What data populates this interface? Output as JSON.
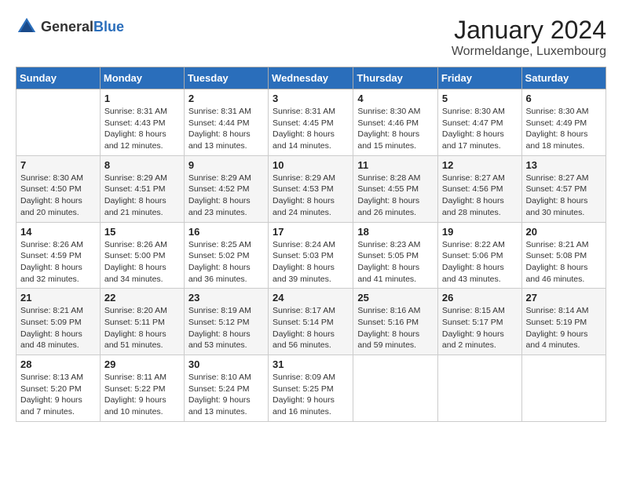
{
  "header": {
    "logo_general": "General",
    "logo_blue": "Blue",
    "month_title": "January 2024",
    "location": "Wormeldange, Luxembourg"
  },
  "days_of_week": [
    "Sunday",
    "Monday",
    "Tuesday",
    "Wednesday",
    "Thursday",
    "Friday",
    "Saturday"
  ],
  "weeks": [
    [
      {
        "num": "",
        "sunrise": "",
        "sunset": "",
        "daylight": ""
      },
      {
        "num": "1",
        "sunrise": "Sunrise: 8:31 AM",
        "sunset": "Sunset: 4:43 PM",
        "daylight": "Daylight: 8 hours and 12 minutes."
      },
      {
        "num": "2",
        "sunrise": "Sunrise: 8:31 AM",
        "sunset": "Sunset: 4:44 PM",
        "daylight": "Daylight: 8 hours and 13 minutes."
      },
      {
        "num": "3",
        "sunrise": "Sunrise: 8:31 AM",
        "sunset": "Sunset: 4:45 PM",
        "daylight": "Daylight: 8 hours and 14 minutes."
      },
      {
        "num": "4",
        "sunrise": "Sunrise: 8:30 AM",
        "sunset": "Sunset: 4:46 PM",
        "daylight": "Daylight: 8 hours and 15 minutes."
      },
      {
        "num": "5",
        "sunrise": "Sunrise: 8:30 AM",
        "sunset": "Sunset: 4:47 PM",
        "daylight": "Daylight: 8 hours and 17 minutes."
      },
      {
        "num": "6",
        "sunrise": "Sunrise: 8:30 AM",
        "sunset": "Sunset: 4:49 PM",
        "daylight": "Daylight: 8 hours and 18 minutes."
      }
    ],
    [
      {
        "num": "7",
        "sunrise": "Sunrise: 8:30 AM",
        "sunset": "Sunset: 4:50 PM",
        "daylight": "Daylight: 8 hours and 20 minutes."
      },
      {
        "num": "8",
        "sunrise": "Sunrise: 8:29 AM",
        "sunset": "Sunset: 4:51 PM",
        "daylight": "Daylight: 8 hours and 21 minutes."
      },
      {
        "num": "9",
        "sunrise": "Sunrise: 8:29 AM",
        "sunset": "Sunset: 4:52 PM",
        "daylight": "Daylight: 8 hours and 23 minutes."
      },
      {
        "num": "10",
        "sunrise": "Sunrise: 8:29 AM",
        "sunset": "Sunset: 4:53 PM",
        "daylight": "Daylight: 8 hours and 24 minutes."
      },
      {
        "num": "11",
        "sunrise": "Sunrise: 8:28 AM",
        "sunset": "Sunset: 4:55 PM",
        "daylight": "Daylight: 8 hours and 26 minutes."
      },
      {
        "num": "12",
        "sunrise": "Sunrise: 8:27 AM",
        "sunset": "Sunset: 4:56 PM",
        "daylight": "Daylight: 8 hours and 28 minutes."
      },
      {
        "num": "13",
        "sunrise": "Sunrise: 8:27 AM",
        "sunset": "Sunset: 4:57 PM",
        "daylight": "Daylight: 8 hours and 30 minutes."
      }
    ],
    [
      {
        "num": "14",
        "sunrise": "Sunrise: 8:26 AM",
        "sunset": "Sunset: 4:59 PM",
        "daylight": "Daylight: 8 hours and 32 minutes."
      },
      {
        "num": "15",
        "sunrise": "Sunrise: 8:26 AM",
        "sunset": "Sunset: 5:00 PM",
        "daylight": "Daylight: 8 hours and 34 minutes."
      },
      {
        "num": "16",
        "sunrise": "Sunrise: 8:25 AM",
        "sunset": "Sunset: 5:02 PM",
        "daylight": "Daylight: 8 hours and 36 minutes."
      },
      {
        "num": "17",
        "sunrise": "Sunrise: 8:24 AM",
        "sunset": "Sunset: 5:03 PM",
        "daylight": "Daylight: 8 hours and 39 minutes."
      },
      {
        "num": "18",
        "sunrise": "Sunrise: 8:23 AM",
        "sunset": "Sunset: 5:05 PM",
        "daylight": "Daylight: 8 hours and 41 minutes."
      },
      {
        "num": "19",
        "sunrise": "Sunrise: 8:22 AM",
        "sunset": "Sunset: 5:06 PM",
        "daylight": "Daylight: 8 hours and 43 minutes."
      },
      {
        "num": "20",
        "sunrise": "Sunrise: 8:21 AM",
        "sunset": "Sunset: 5:08 PM",
        "daylight": "Daylight: 8 hours and 46 minutes."
      }
    ],
    [
      {
        "num": "21",
        "sunrise": "Sunrise: 8:21 AM",
        "sunset": "Sunset: 5:09 PM",
        "daylight": "Daylight: 8 hours and 48 minutes."
      },
      {
        "num": "22",
        "sunrise": "Sunrise: 8:20 AM",
        "sunset": "Sunset: 5:11 PM",
        "daylight": "Daylight: 8 hours and 51 minutes."
      },
      {
        "num": "23",
        "sunrise": "Sunrise: 8:19 AM",
        "sunset": "Sunset: 5:12 PM",
        "daylight": "Daylight: 8 hours and 53 minutes."
      },
      {
        "num": "24",
        "sunrise": "Sunrise: 8:17 AM",
        "sunset": "Sunset: 5:14 PM",
        "daylight": "Daylight: 8 hours and 56 minutes."
      },
      {
        "num": "25",
        "sunrise": "Sunrise: 8:16 AM",
        "sunset": "Sunset: 5:16 PM",
        "daylight": "Daylight: 8 hours and 59 minutes."
      },
      {
        "num": "26",
        "sunrise": "Sunrise: 8:15 AM",
        "sunset": "Sunset: 5:17 PM",
        "daylight": "Daylight: 9 hours and 2 minutes."
      },
      {
        "num": "27",
        "sunrise": "Sunrise: 8:14 AM",
        "sunset": "Sunset: 5:19 PM",
        "daylight": "Daylight: 9 hours and 4 minutes."
      }
    ],
    [
      {
        "num": "28",
        "sunrise": "Sunrise: 8:13 AM",
        "sunset": "Sunset: 5:20 PM",
        "daylight": "Daylight: 9 hours and 7 minutes."
      },
      {
        "num": "29",
        "sunrise": "Sunrise: 8:11 AM",
        "sunset": "Sunset: 5:22 PM",
        "daylight": "Daylight: 9 hours and 10 minutes."
      },
      {
        "num": "30",
        "sunrise": "Sunrise: 8:10 AM",
        "sunset": "Sunset: 5:24 PM",
        "daylight": "Daylight: 9 hours and 13 minutes."
      },
      {
        "num": "31",
        "sunrise": "Sunrise: 8:09 AM",
        "sunset": "Sunset: 5:25 PM",
        "daylight": "Daylight: 9 hours and 16 minutes."
      },
      {
        "num": "",
        "sunrise": "",
        "sunset": "",
        "daylight": ""
      },
      {
        "num": "",
        "sunrise": "",
        "sunset": "",
        "daylight": ""
      },
      {
        "num": "",
        "sunrise": "",
        "sunset": "",
        "daylight": ""
      }
    ]
  ]
}
